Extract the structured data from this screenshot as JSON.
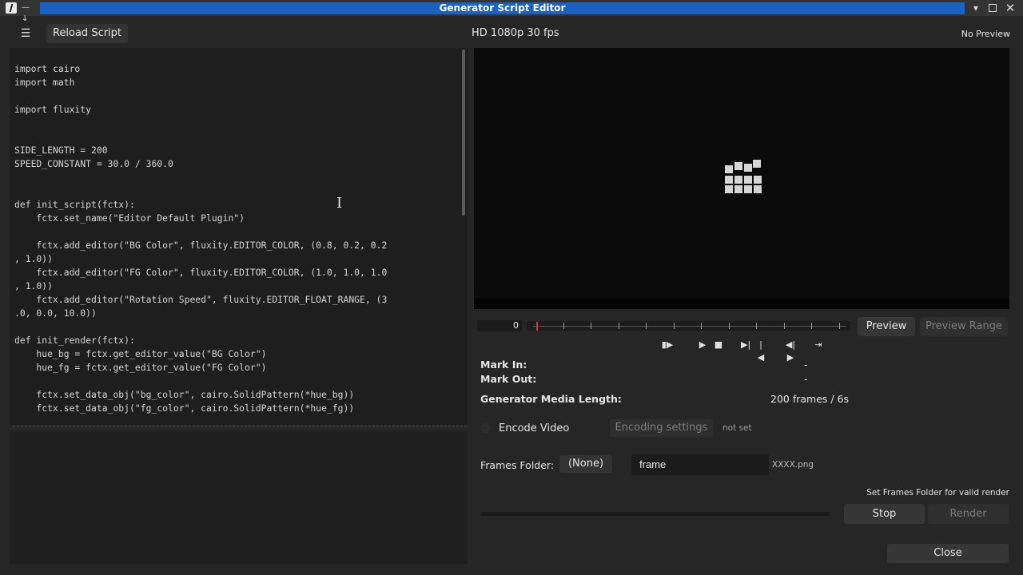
{
  "window": {
    "title": "Generator Script Editor",
    "app_icon": "app-icon",
    "controls": [
      "minimize-icon",
      "maximize-icon",
      "close-icon"
    ]
  },
  "toolbar": {
    "menu_icon": "hamburger-menu-icon",
    "reload_label": "Reload Script",
    "profile": "HD 1080p 30 fps",
    "preview_status": "No Preview"
  },
  "editor": {
    "lines": [
      "import cairo",
      "import math",
      "",
      "import fluxity",
      "",
      "",
      "SIDE_LENGTH = 200",
      "SPEED_CONSTANT = 30.0 / 360.0",
      "",
      "",
      "def init_script(fctx):",
      "    fctx.set_name(\"Editor Default Plugin\")",
      "",
      "    fctx.add_editor(\"BG Color\", fluxity.EDITOR_COLOR, (0.8, 0.2, 0.2",
      ", 1.0))",
      "    fctx.add_editor(\"FG Color\", fluxity.EDITOR_COLOR, (1.0, 1.0, 1.0",
      ", 1.0))",
      "    fctx.add_editor(\"Rotation Speed\", fluxity.EDITOR_FLOAT_RANGE, (3",
      ".0, 0.0, 10.0))",
      "",
      "def init_render(fctx):",
      "    hue_bg = fctx.get_editor_value(\"BG Color\")",
      "    hue_fg = fctx.get_editor_value(\"FG Color\")",
      "",
      "    fctx.set_data_obj(\"bg_color\", cairo.SolidPattern(*hue_bg))",
      "    fctx.set_data_obj(\"fg_color\", cairo.SolidPattern(*hue_fg))"
    ]
  },
  "preview": {
    "placeholder_icon": "grid-placeholder-icon"
  },
  "timeline": {
    "frame": "0",
    "position_fraction": 0.0,
    "preview_label": "Preview",
    "preview_range_label": "Preview Range",
    "transport": [
      "play-range-icon",
      "play-icon",
      "stop-icon",
      "mark-in-icon",
      "mark-out-icon",
      "clear-marks-icon",
      "to-mark-icon"
    ]
  },
  "info": {
    "mark_in_label": "Mark In:",
    "mark_in_value": "-",
    "mark_out_label": "Mark Out:",
    "mark_out_value": "-",
    "length_label": "Generator Media Length:",
    "length_value": "200 frames / 6s"
  },
  "encode": {
    "label": "Encode Video",
    "checked": false,
    "settings_label": "Encoding settings",
    "status": "not set"
  },
  "frames": {
    "label": "Frames Folder:",
    "folder_value": "(None)",
    "name_value": "frame",
    "extension": "XXXX.png"
  },
  "render": {
    "warning": "Set Frames Folder for valid render",
    "progress": 0,
    "stop_label": "Stop",
    "render_label": "Render",
    "close_label": "Close"
  },
  "colors": {
    "title_accent": "#1a61c4",
    "playhead": "#e03030",
    "background": "#262626"
  }
}
